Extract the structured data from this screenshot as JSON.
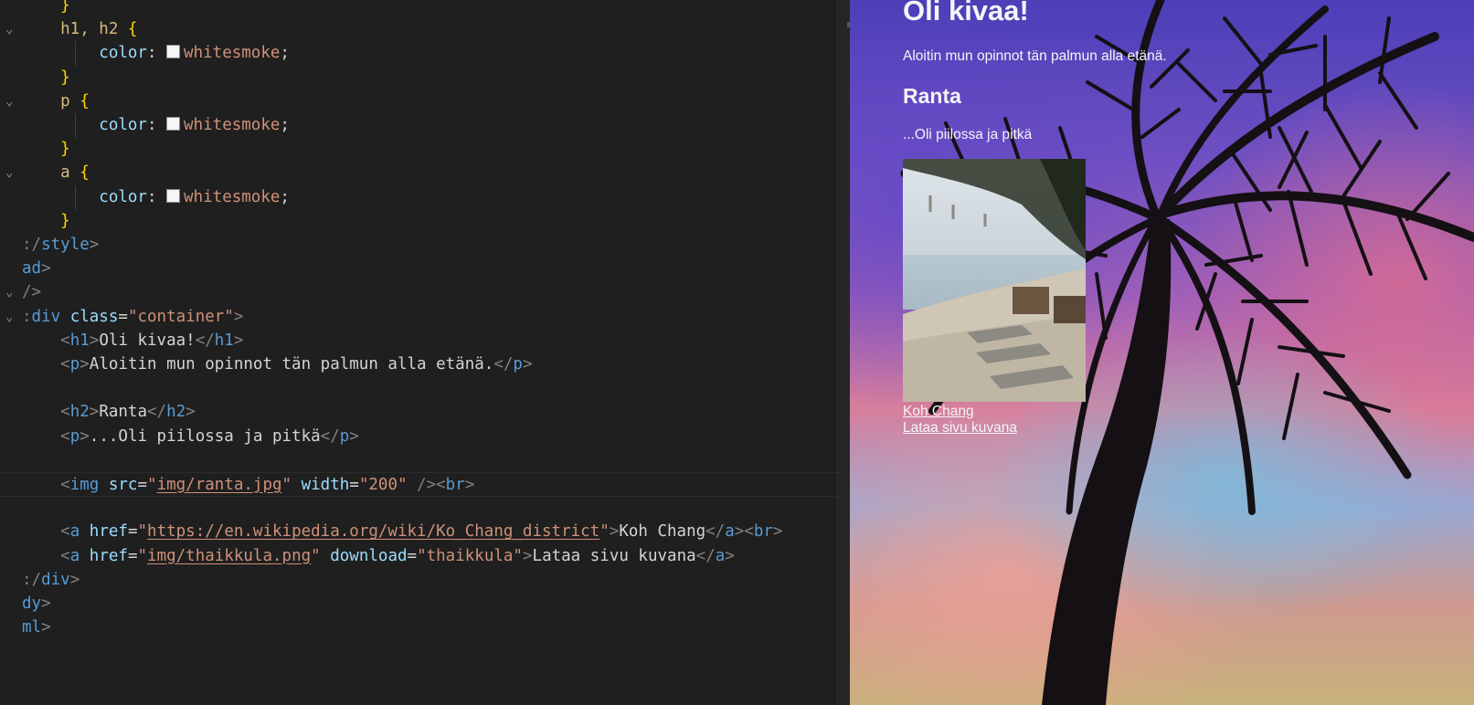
{
  "editor": {
    "lines": [
      {
        "parts": [
          [
            "t-brace",
            "    }"
          ]
        ]
      },
      {
        "fold": true,
        "parts": [
          [
            "t-sel",
            "    h1, h2 "
          ],
          [
            "t-brace",
            "{"
          ]
        ]
      },
      {
        "guide": true,
        "parts": [
          [
            "t-prop",
            "        color"
          ],
          [
            "t-txt",
            ": "
          ],
          [
            "swatch",
            ""
          ],
          [
            "t-val",
            "whitesmoke"
          ],
          [
            "t-txt",
            ";"
          ]
        ]
      },
      {
        "parts": [
          [
            "t-brace",
            "    }"
          ]
        ]
      },
      {
        "fold": true,
        "parts": [
          [
            "t-sel",
            "    p "
          ],
          [
            "t-brace",
            "{"
          ]
        ]
      },
      {
        "guide": true,
        "parts": [
          [
            "t-prop",
            "        color"
          ],
          [
            "t-txt",
            ": "
          ],
          [
            "swatch",
            ""
          ],
          [
            "t-val",
            "whitesmoke"
          ],
          [
            "t-txt",
            ";"
          ]
        ]
      },
      {
        "parts": [
          [
            "t-brace",
            "    }"
          ]
        ]
      },
      {
        "fold": true,
        "parts": [
          [
            "t-sel",
            "    a "
          ],
          [
            "t-brace",
            "{"
          ]
        ]
      },
      {
        "guide": true,
        "parts": [
          [
            "t-prop",
            "        color"
          ],
          [
            "t-txt",
            ": "
          ],
          [
            "swatch",
            ""
          ],
          [
            "t-val",
            "whitesmoke"
          ],
          [
            "t-txt",
            ";"
          ]
        ]
      },
      {
        "parts": [
          [
            "t-brace",
            "    }"
          ]
        ]
      },
      {
        "parts": [
          [
            "t-br",
            ":/"
          ],
          [
            "t-tag",
            "style"
          ],
          [
            "t-br",
            ">"
          ]
        ]
      },
      {
        "parts": [
          [
            "t-tag",
            "ad"
          ],
          [
            "t-br",
            ">"
          ]
        ]
      },
      {
        "fold": true,
        "parts": [
          [
            "t-br",
            "/>"
          ]
        ]
      },
      {
        "fold": true,
        "parts": [
          [
            "t-br",
            ":"
          ],
          [
            "t-tag",
            "div "
          ],
          [
            "t-attr",
            "class"
          ],
          [
            "t-txt",
            "="
          ],
          [
            "t-str",
            "\"container\""
          ],
          [
            "t-br",
            ">"
          ]
        ]
      },
      {
        "parts": [
          [
            "t-txt",
            "    "
          ],
          [
            "t-br",
            "<"
          ],
          [
            "t-tag",
            "h1"
          ],
          [
            "t-br",
            ">"
          ],
          [
            "t-txt",
            "Oli kivaa!"
          ],
          [
            "t-br",
            "</"
          ],
          [
            "t-tag",
            "h1"
          ],
          [
            "t-br",
            ">"
          ]
        ]
      },
      {
        "parts": [
          [
            "t-txt",
            "    "
          ],
          [
            "t-br",
            "<"
          ],
          [
            "t-tag",
            "p"
          ],
          [
            "t-br",
            ">"
          ],
          [
            "t-txt",
            "Aloitin mun opinnot tän palmun alla etänä."
          ],
          [
            "t-br",
            "</"
          ],
          [
            "t-tag",
            "p"
          ],
          [
            "t-br",
            ">"
          ]
        ]
      },
      {
        "parts": [
          [
            "t-txt",
            ""
          ]
        ]
      },
      {
        "parts": [
          [
            "t-txt",
            "    "
          ],
          [
            "t-br",
            "<"
          ],
          [
            "t-tag",
            "h2"
          ],
          [
            "t-br",
            ">"
          ],
          [
            "t-txt",
            "Ranta"
          ],
          [
            "t-br",
            "</"
          ],
          [
            "t-tag",
            "h2"
          ],
          [
            "t-br",
            ">"
          ]
        ]
      },
      {
        "parts": [
          [
            "t-txt",
            "    "
          ],
          [
            "t-br",
            "<"
          ],
          [
            "t-tag",
            "p"
          ],
          [
            "t-br",
            ">"
          ],
          [
            "t-txt",
            "...Oli piilossa ja pitkä"
          ],
          [
            "t-br",
            "</"
          ],
          [
            "t-tag",
            "p"
          ],
          [
            "t-br",
            ">"
          ]
        ]
      },
      {
        "parts": [
          [
            "t-txt",
            ""
          ]
        ]
      },
      {
        "current": true,
        "parts": [
          [
            "t-txt",
            "    "
          ],
          [
            "t-br",
            "<"
          ],
          [
            "t-tag",
            "img "
          ],
          [
            "t-attr",
            "src"
          ],
          [
            "t-txt",
            "="
          ],
          [
            "t-str",
            "\""
          ],
          [
            "t-str u",
            "img/ranta.jpg"
          ],
          [
            "t-str",
            "\" "
          ],
          [
            "t-attr",
            "width"
          ],
          [
            "t-txt",
            "="
          ],
          [
            "t-str",
            "\"200\" "
          ],
          [
            "t-br",
            "/><"
          ],
          [
            "t-tag",
            "br"
          ],
          [
            "t-br",
            ">"
          ]
        ]
      },
      {
        "parts": [
          [
            "t-txt",
            ""
          ]
        ]
      },
      {
        "parts": [
          [
            "t-txt",
            "    "
          ],
          [
            "t-br",
            "<"
          ],
          [
            "t-tag",
            "a "
          ],
          [
            "t-attr",
            "href"
          ],
          [
            "t-txt",
            "="
          ],
          [
            "t-str",
            "\""
          ],
          [
            "t-str u",
            "https://en.wikipedia.org/wiki/Ko_Chang_district"
          ],
          [
            "t-str",
            "\""
          ],
          [
            "t-br",
            ">"
          ],
          [
            "t-txt",
            "Koh Chang"
          ],
          [
            "t-br",
            "</"
          ],
          [
            "t-tag",
            "a"
          ],
          [
            "t-br",
            "><"
          ],
          [
            "t-tag",
            "br"
          ],
          [
            "t-br",
            ">"
          ]
        ]
      },
      {
        "parts": [
          [
            "t-txt",
            "    "
          ],
          [
            "t-br",
            "<"
          ],
          [
            "t-tag",
            "a "
          ],
          [
            "t-attr",
            "href"
          ],
          [
            "t-txt",
            "="
          ],
          [
            "t-str",
            "\""
          ],
          [
            "t-str u",
            "img/thaikkula.png"
          ],
          [
            "t-str",
            "\" "
          ],
          [
            "t-attr",
            "download"
          ],
          [
            "t-txt",
            "="
          ],
          [
            "t-str",
            "\"thaikkula\""
          ],
          [
            "t-br",
            ">"
          ],
          [
            "t-txt",
            "Lataa sivu kuvana"
          ],
          [
            "t-br",
            "</"
          ],
          [
            "t-tag",
            "a"
          ],
          [
            "t-br",
            ">"
          ]
        ]
      },
      {
        "parts": [
          [
            "t-br",
            ":/"
          ],
          [
            "t-tag",
            "div"
          ],
          [
            "t-br",
            ">"
          ]
        ]
      },
      {
        "parts": [
          [
            "t-tag",
            "dy"
          ],
          [
            "t-br",
            ">"
          ]
        ]
      },
      {
        "parts": [
          [
            "t-tag",
            "ml"
          ],
          [
            "t-br",
            ">"
          ]
        ]
      }
    ]
  },
  "preview": {
    "h1": "Oli kivaa!",
    "p1": "Aloitin mun opinnot tän palmun alla etänä.",
    "h2": "Ranta",
    "p2": "...Oli piilossa ja pitkä",
    "link1": "Koh Chang",
    "link2": "Lataa sivu kuvana",
    "text_color": "#f5f5f5"
  }
}
